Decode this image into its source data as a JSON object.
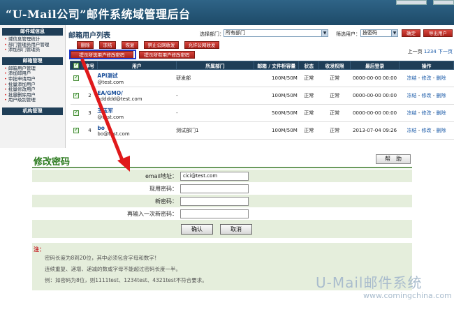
{
  "app": {
    "title": "“U-Mail公司”邮件系统域管理后台"
  },
  "sidebar": {
    "sections": [
      {
        "heading": "邮件域信息",
        "items": [
          "域信息管理统计",
          "部门管理员用户管理",
          "添加部门管理员"
        ]
      },
      {
        "heading": "邮箱管理",
        "items": [
          "邮箱用户管理",
          "添加邮用户",
          "审批申请用户",
          "批量添加用户",
          "批量修改用户",
          "批量删除用户",
          "用户级别管理"
        ]
      },
      {
        "heading": "机构管理",
        "items": []
      }
    ]
  },
  "main": {
    "title": "邮箱用户列表",
    "filter_dept_label": "选择部门：",
    "filter_dept_value": "所有部门",
    "filter_cond_label": "筛选用户：",
    "filter_cond_value": "按密码",
    "confirm_label": "确定",
    "export_label": "导出用户",
    "actions": [
      "删除",
      "冻结",
      "恢复",
      "禁止公网收发",
      "允许公网收发"
    ],
    "actions2": [
      "提示所选用户修改密码",
      "提示所有用户修改密码"
    ],
    "pager": {
      "prefix": "上一页",
      "pages": [
        "1",
        "2",
        "3",
        "4"
      ],
      "suffix": "下一页"
    }
  },
  "table": {
    "headers": [
      "序号",
      "用户",
      "所属部门",
      "邮箱 / 文件柜容量",
      "状态",
      "收发权限",
      "最后登录",
      "操作"
    ],
    "rows": [
      {
        "no": "1",
        "name": "API测试",
        "email": "@test.com",
        "dept": "研发部",
        "quota": "100M/50M",
        "status": "正常",
        "perm": "正常",
        "last": "0000-00-00 00:00",
        "ops": [
          "冻结",
          "修改",
          "删除"
        ]
      },
      {
        "no": "2",
        "name": "EA/GMO/",
        "email": "addddd@test.com",
        "dept": "-",
        "quota": "100M/50M",
        "status": "正常",
        "perm": "正常",
        "last": "0000-00-00 00:00",
        "ops": [
          "冻结",
          "修改",
          "删除"
        ]
      },
      {
        "no": "3",
        "name": "王玉军",
        "email": "@test.com",
        "dept": "-",
        "quota": "500M/50M",
        "status": "正常",
        "perm": "正常",
        "last": "0000-00-00 00:00",
        "ops": [
          "冻结",
          "修改",
          "删除"
        ]
      },
      {
        "no": "4",
        "name": "bo",
        "email": "bo@test.com",
        "dept": "测试部门1",
        "quota": "100M/50M",
        "status": "正常",
        "perm": "正常",
        "last": "2013-07-04 09:26",
        "ops": [
          "冻结",
          "修改",
          "删除"
        ]
      }
    ]
  },
  "password_form": {
    "title": "修改密码",
    "help_label": "帮　助",
    "email_label": "email地址：",
    "email_value": "cici@test.com",
    "current_label": "现用密码：",
    "new_label": "新密码：",
    "repeat_label": "再输入一次新密码：",
    "ok_label": "确认",
    "cancel_label": "取消",
    "note_label": "注：",
    "notes": [
      "密码长度为8到20位，其中必须包含字母和数字！",
      "连续重复、递增、递减的数或字母不能超过密码长度一半。",
      "例：如密码为8位，则1111test、1234test、4321test不符合要求。"
    ]
  },
  "watermark": {
    "brand": "U-Mail邮件系统",
    "site": "www.comingchina.com"
  },
  "colors": {
    "header": "#1d4a68",
    "accent_red": "#c4141a",
    "form_title": "#2b7a1e",
    "highlight_box": "#2239c8"
  }
}
